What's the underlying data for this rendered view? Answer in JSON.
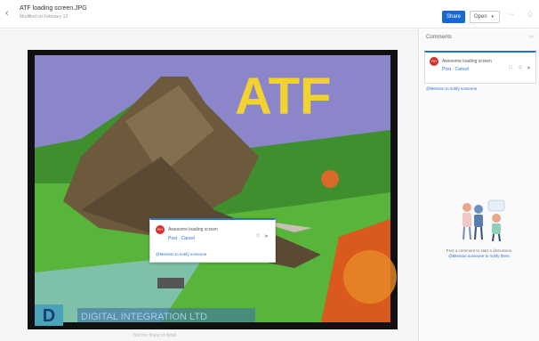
{
  "header": {
    "title": "ATF loading screen.JPG",
    "subtitle": "Modified on February 12",
    "share_label": "Share",
    "open_label": "Open",
    "more_label": "···"
  },
  "image": {
    "headline": "ATF",
    "logo_letter": "D",
    "banner": "DIGITAL INTEGRATION LTD",
    "caption": "Not the finest of detail"
  },
  "comment_popup": {
    "avatar": "RH",
    "text": "Awesome loading screen",
    "post_label": "Post",
    "cancel_label": "Cancel",
    "mention_hint": "@Mention to notify someone"
  },
  "panel": {
    "title": "Comments",
    "card": {
      "avatar": "RH",
      "text": "Awesome loading screen",
      "post_label": "Post",
      "cancel_label": "Cancel"
    },
    "mention_hint": "@Mention to notify someone",
    "empty_text": "Post a comment to start a discussion.",
    "empty_link": "@Mention someone to notify them."
  },
  "colors": {
    "accent": "#1769d1",
    "avatar": "#d9302c"
  }
}
